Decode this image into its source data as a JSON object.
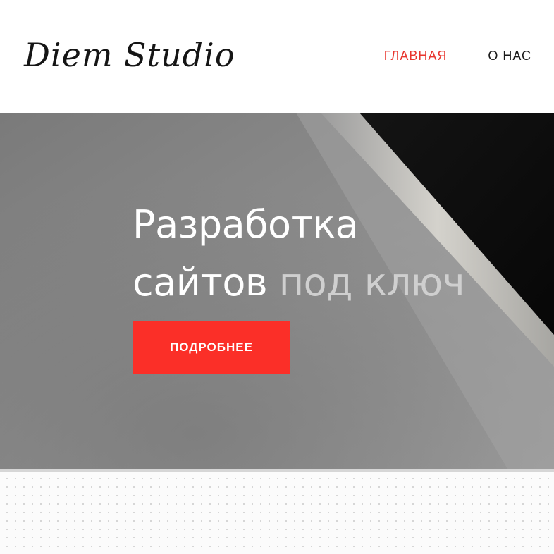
{
  "header": {
    "logo_text": "Diem Studio",
    "nav": [
      {
        "label": "ГЛАВНАЯ",
        "active": true
      },
      {
        "label": "О НАС",
        "active": false
      }
    ]
  },
  "hero": {
    "title_line1": "Разработка",
    "title_line2_main": "сайтов",
    "title_line2_muted": "под ключ",
    "button_label": "ПОДРОБНЕЕ"
  },
  "colors": {
    "accent": "#fb2f28",
    "nav_active": "#e8362e",
    "text_dark": "#1a1a1a",
    "hero_text": "#ffffff",
    "hero_text_muted": "#cfcfcf"
  }
}
